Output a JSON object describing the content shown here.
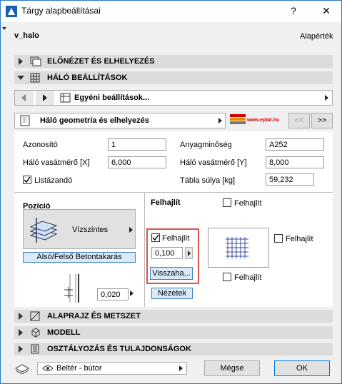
{
  "window": {
    "title": "Tárgy alapbeállításai",
    "help_label": "?",
    "close_label": "✕"
  },
  "header": {
    "object_name": "v_halo",
    "defaults_label": "Alapérték"
  },
  "sections": {
    "preview": "ELŐNÉZET ÉS ELHELYEZÉS",
    "mesh": "HÁLÓ BEÁLLÍTÁSOK",
    "plan": "ALAPRAJZ ÉS METSZET",
    "model": "MODELL",
    "classification": "OSZTÁLYOZÁS ÉS TULAJDONSÁGOK"
  },
  "custom_settings": {
    "label": "Egyéni beállítások..."
  },
  "geometry": {
    "label": "Háló geometria és elhelyezés",
    "brand": "www.eptar.hu",
    "prev_label": "<<",
    "next_label": ">>"
  },
  "fields": {
    "id_label": "Azonosító",
    "id_value": "1",
    "material_label": "Anyagminőség",
    "material_value": "A252",
    "rebar_x_label": "Háló vasátmérő [X]",
    "rebar_x_value": "6,000",
    "rebar_y_label": "Háló vasátmérő [Y]",
    "rebar_y_value": "8,000",
    "listable_label": "Listázandó",
    "weight_label": "Tábla súlya [kg]",
    "weight_value": "59,232"
  },
  "position": {
    "title": "Pozíció",
    "orientation": "Vízszintes",
    "cover_label": "Alsó/Felső Betontakarás",
    "cover_value": "0,020"
  },
  "bend": {
    "title": "Felhajlít",
    "top_label": "Felhajlít",
    "left_label": "Felhajlít",
    "left_value": "0,100",
    "back_label": "Visszaha...",
    "right_label": "Felhajlít",
    "bottom_label": "Felhajlít",
    "views_label": "Nézetek"
  },
  "footer": {
    "layer_label": "Beltér - bútor",
    "cancel_label": "Mégse",
    "ok_label": "OK"
  }
}
